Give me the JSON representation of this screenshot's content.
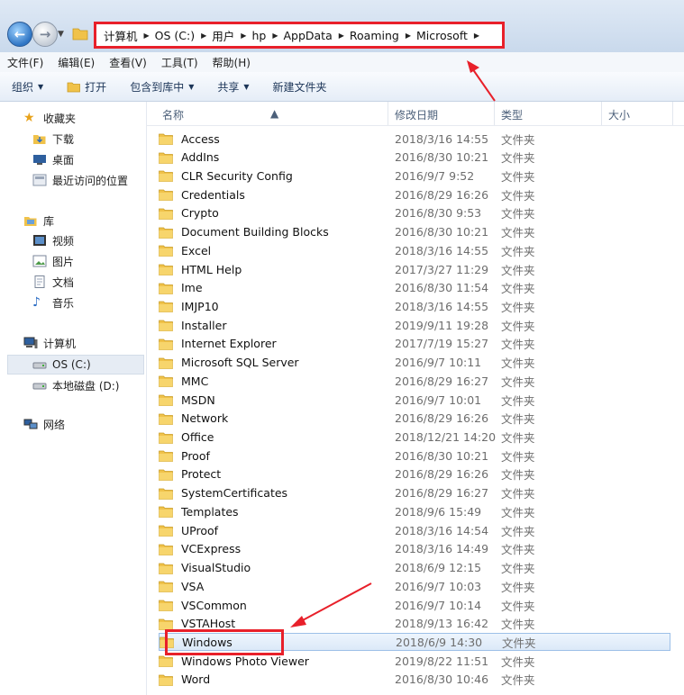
{
  "breadcrumb": [
    "计算机",
    "OS (C:)",
    "用户",
    "hp",
    "AppData",
    "Roaming",
    "Microsoft"
  ],
  "menu": [
    "文件(F)",
    "编辑(E)",
    "查看(V)",
    "工具(T)",
    "帮助(H)"
  ],
  "toolbar": {
    "organize": "组织",
    "open": "打开",
    "include": "包含到库中",
    "share": "共享",
    "new_folder": "新建文件夹"
  },
  "nav": {
    "favorites": "收藏夹",
    "downloads": "下载",
    "desktop": "桌面",
    "recent": "最近访问的位置",
    "libraries": "库",
    "videos": "视频",
    "pictures": "图片",
    "documents": "文档",
    "music": "音乐",
    "computer": "计算机",
    "drive_c": "OS (C:)",
    "drive_d": "本地磁盘 (D:)",
    "network": "网络"
  },
  "columns": {
    "name": "名称",
    "modified": "修改日期",
    "type": "类型",
    "size": "大小"
  },
  "files": [
    {
      "name": "Access",
      "date": "2018/3/16 14:55",
      "type": "文件夹"
    },
    {
      "name": "AddIns",
      "date": "2016/8/30 10:21",
      "type": "文件夹"
    },
    {
      "name": "CLR Security Config",
      "date": "2016/9/7 9:52",
      "type": "文件夹"
    },
    {
      "name": "Credentials",
      "date": "2016/8/29 16:26",
      "type": "文件夹"
    },
    {
      "name": "Crypto",
      "date": "2016/8/30 9:53",
      "type": "文件夹"
    },
    {
      "name": "Document Building Blocks",
      "date": "2016/8/30 10:21",
      "type": "文件夹"
    },
    {
      "name": "Excel",
      "date": "2018/3/16 14:55",
      "type": "文件夹"
    },
    {
      "name": "HTML Help",
      "date": "2017/3/27 11:29",
      "type": "文件夹"
    },
    {
      "name": "Ime",
      "date": "2016/8/30 11:54",
      "type": "文件夹"
    },
    {
      "name": "IMJP10",
      "date": "2018/3/16 14:55",
      "type": "文件夹"
    },
    {
      "name": "Installer",
      "date": "2019/9/11 19:28",
      "type": "文件夹"
    },
    {
      "name": "Internet Explorer",
      "date": "2017/7/19 15:27",
      "type": "文件夹"
    },
    {
      "name": "Microsoft SQL Server",
      "date": "2016/9/7 10:11",
      "type": "文件夹"
    },
    {
      "name": "MMC",
      "date": "2016/8/29 16:27",
      "type": "文件夹"
    },
    {
      "name": "MSDN",
      "date": "2016/9/7 10:01",
      "type": "文件夹"
    },
    {
      "name": "Network",
      "date": "2016/8/29 16:26",
      "type": "文件夹"
    },
    {
      "name": "Office",
      "date": "2018/12/21 14:20",
      "type": "文件夹"
    },
    {
      "name": "Proof",
      "date": "2016/8/30 10:21",
      "type": "文件夹"
    },
    {
      "name": "Protect",
      "date": "2016/8/29 16:26",
      "type": "文件夹"
    },
    {
      "name": "SystemCertificates",
      "date": "2016/8/29 16:27",
      "type": "文件夹"
    },
    {
      "name": "Templates",
      "date": "2018/9/6 15:49",
      "type": "文件夹"
    },
    {
      "name": "UProof",
      "date": "2018/3/16 14:54",
      "type": "文件夹"
    },
    {
      "name": "VCExpress",
      "date": "2018/3/16 14:49",
      "type": "文件夹"
    },
    {
      "name": "VisualStudio",
      "date": "2018/6/9 12:15",
      "type": "文件夹"
    },
    {
      "name": "VSA",
      "date": "2016/9/7 10:03",
      "type": "文件夹"
    },
    {
      "name": "VSCommon",
      "date": "2016/9/7 10:14",
      "type": "文件夹"
    },
    {
      "name": "VSTAHost",
      "date": "2018/9/13 16:42",
      "type": "文件夹"
    },
    {
      "name": "Windows",
      "date": "2018/6/9 14:30",
      "type": "文件夹"
    },
    {
      "name": "Windows Photo Viewer",
      "date": "2019/8/22 11:51",
      "type": "文件夹"
    },
    {
      "name": "Word",
      "date": "2016/8/30 10:46",
      "type": "文件夹"
    }
  ],
  "selected_file": "Windows",
  "colors": {
    "highlight": "#e8202a",
    "folder": "#f0c24a",
    "selection": "#dce9f8"
  }
}
